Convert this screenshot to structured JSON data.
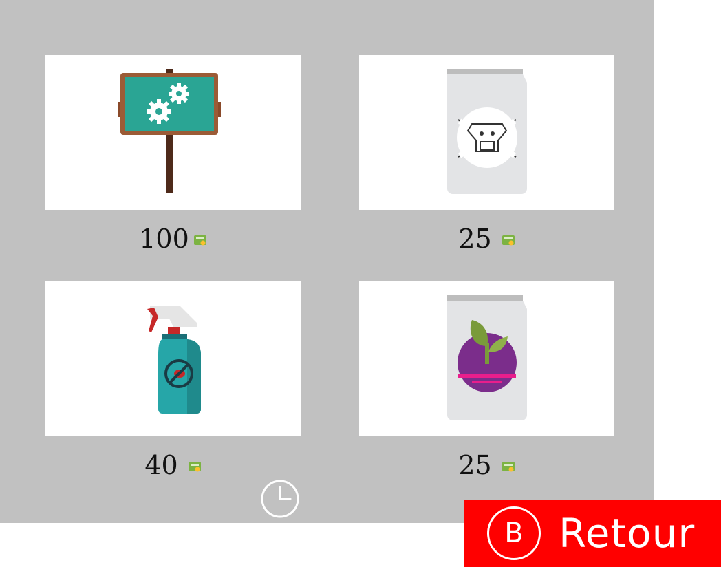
{
  "shop": {
    "items": [
      {
        "name": "sign-board",
        "price": "100",
        "icon": "gear-sign-board-icon"
      },
      {
        "name": "poison-bag",
        "price": "25",
        "icon": "skull-crossbones-bag-icon"
      },
      {
        "name": "insecticide-spray",
        "price": "40",
        "icon": "bug-spray-bottle-icon"
      },
      {
        "name": "seed-bag",
        "price": "25",
        "icon": "plum-seed-bag-icon"
      }
    ],
    "currency_icon": "cash-icon",
    "timer_icon": "clock-icon"
  },
  "back_button": {
    "key": "B",
    "label": "Retour"
  },
  "colors": {
    "panel": "#c1c1c1",
    "card": "#ffffff",
    "back_button": "#ff0000",
    "cash": "#8bc34a"
  }
}
